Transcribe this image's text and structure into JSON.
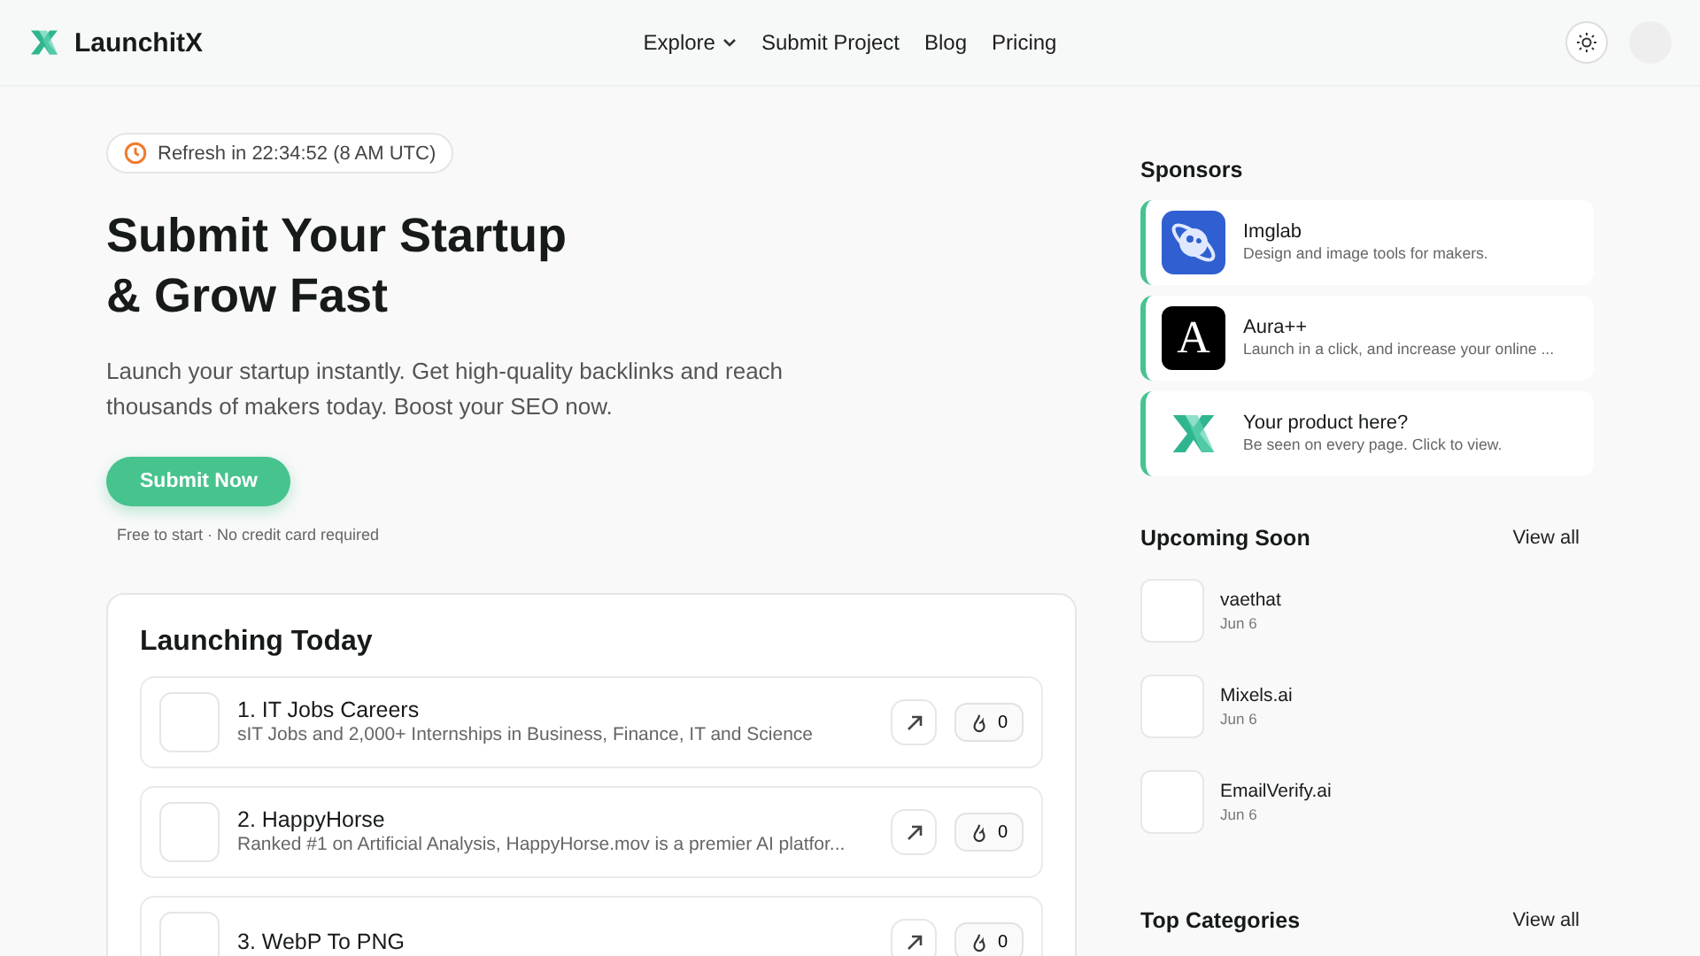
{
  "header": {
    "brand": "LaunchitX",
    "nav": [
      {
        "label": "Explore",
        "dropdown": true
      },
      {
        "label": "Submit Project",
        "dropdown": false
      },
      {
        "label": "Blog",
        "dropdown": false
      },
      {
        "label": "Pricing",
        "dropdown": false
      }
    ]
  },
  "hero": {
    "refresh": "Refresh in 22:34:52 (8 AM UTC)",
    "title_lines": [
      "Submit Your Startup",
      "& Grow Fast"
    ],
    "subtitle": "Launch your startup instantly. Get high-quality backlinks and reach thousands of makers today. Boost your SEO now.",
    "cta": "Submit Now",
    "note": "Free to start · No credit card required"
  },
  "launching": {
    "title": "Launching Today",
    "items": [
      {
        "name": "1. IT Jobs Careers",
        "description": "sIT Jobs and 2,000+ Internships in Business, Finance, IT and Science",
        "votes": "0"
      },
      {
        "name": "2. HappyHorse",
        "description": "Ranked #1 on Artificial Analysis, HappyHorse.mov is a premier AI platfor...",
        "votes": "0"
      },
      {
        "name": "3. WebP To PNG",
        "votes": "0"
      }
    ]
  },
  "sponsors": {
    "title": "Sponsors",
    "items": [
      {
        "kind": "planet",
        "name": "Imglab",
        "description": "Design and image tools for makers."
      },
      {
        "kind": "letter",
        "name": "Aura++",
        "description": "Launch in a click, and increase your online ...",
        "letter": "A"
      },
      {
        "kind": "brand",
        "name": "Your product here?",
        "description": "Be seen on every page. Click to view."
      }
    ]
  },
  "upcoming": {
    "title": "Upcoming Soon",
    "view_all": "View all",
    "items": [
      {
        "name": "vaethat",
        "date": "Jun 6"
      },
      {
        "name": "Mixels.ai",
        "date": "Jun 6"
      },
      {
        "name": "EmailVerify.ai",
        "date": "Jun 6"
      }
    ]
  },
  "categories": {
    "title": "Top Categories",
    "view_all": "View all"
  }
}
